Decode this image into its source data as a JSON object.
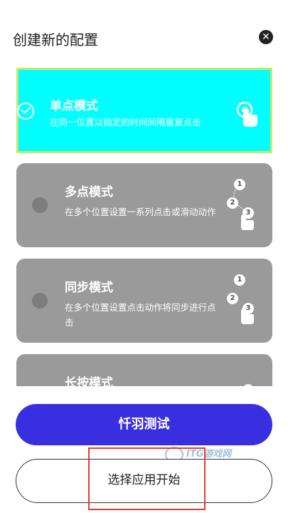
{
  "dialog": {
    "title": "创建新的配置",
    "close_label": "✕"
  },
  "modes": [
    {
      "name": "单点模式",
      "description": "在同一位置以指定的时间间隔重复点击",
      "selected": true,
      "icon": "single-tap-icon"
    },
    {
      "name": "多点模式",
      "description": "在多个位置设置一系列点击或滑动动作",
      "selected": false,
      "icon": "multi-tap-icon",
      "icon_numbers": [
        "1",
        "2",
        "3"
      ]
    },
    {
      "name": "同步模式",
      "description": "在多个位置设置点击动作将同步进行点击",
      "selected": false,
      "icon": "sync-tap-icon",
      "icon_numbers": [
        "1",
        "2",
        "3"
      ]
    },
    {
      "name": "长按模式",
      "description": "",
      "selected": false,
      "icon": "long-press-icon"
    }
  ],
  "buttons": {
    "primary_label": "忏羽测试",
    "secondary_label": "选择应用开始"
  },
  "watermark": {
    "text": "ITG游戏网"
  },
  "colors": {
    "selected_card": "#00ffff",
    "selected_border": "#c8e86a",
    "card_bg": "#9a9a9a",
    "primary_button": "#3a2fe0",
    "highlight": "#e53935"
  }
}
